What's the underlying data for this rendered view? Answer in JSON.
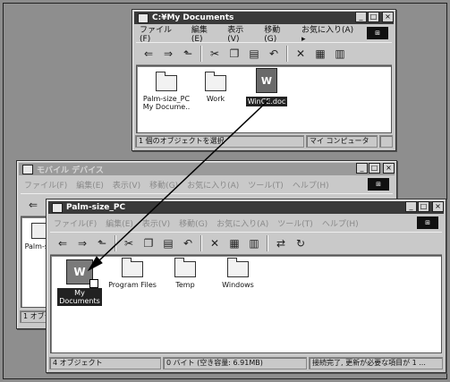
{
  "win1": {
    "title": "C:¥My Documents",
    "menu": [
      "ファイル(F)",
      "編集(E)",
      "表示(V)",
      "移動(G)",
      "お気に入り(A) ▸"
    ],
    "items": [
      {
        "label": "Palm-size_PC\nMy Docume..",
        "icon": "folder-icon"
      },
      {
        "label": "Work",
        "icon": "folder-icon"
      },
      {
        "label": "WinCE.doc",
        "icon": "word-document-icon"
      }
    ],
    "status": [
      "1 個のオブジェクトを選択",
      "マイ コンピュータ"
    ]
  },
  "win2": {
    "title": "モバイル デバイス",
    "menu": [
      "ファイル(F)",
      "編集(E)",
      "表示(V)",
      "移動(G)",
      "お気に入り(A)",
      "ツール(T)",
      "ヘルプ(H)"
    ],
    "side_label": "Palm-siz",
    "status": [
      "1 オブジェ"
    ]
  },
  "win3": {
    "title": "Palm-size_PC",
    "menu": [
      "ファイル(F)",
      "編集(E)",
      "表示(V)",
      "移動(G)",
      "お気に入り(A)",
      "ツール(T)",
      "ヘルプ(H)"
    ],
    "items": [
      {
        "label": "My\nDocuments",
        "icon": "my-documents-folder-icon"
      },
      {
        "label": "Program Files",
        "icon": "folder-icon"
      },
      {
        "label": "Temp",
        "icon": "folder-icon"
      },
      {
        "label": "Windows",
        "icon": "folder-icon"
      }
    ],
    "status": [
      "4 オブジェクト",
      "0 バイト (空き容量: 6.91MB)",
      "接続完了, 更新が必要な項目が 1 ..."
    ]
  },
  "window_buttons": [
    "_",
    "□",
    "×"
  ],
  "brand_logo_text": "⊞"
}
